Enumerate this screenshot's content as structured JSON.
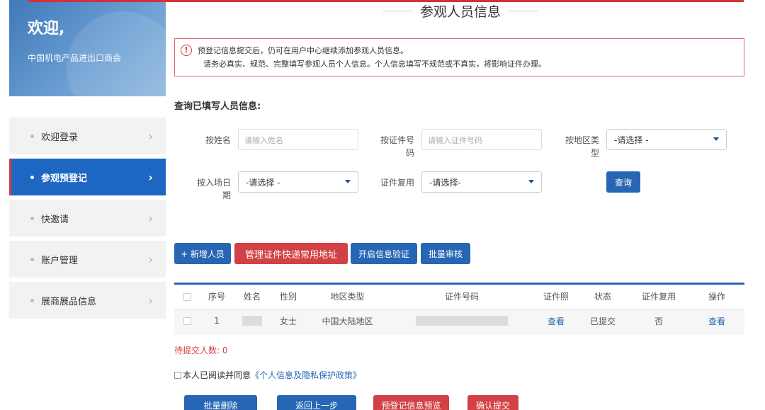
{
  "sidebar": {
    "welcome_title": "欢迎,",
    "organization": "中国机电产品进出口商会",
    "items": [
      {
        "label": "欢迎登录",
        "active": false
      },
      {
        "label": "参观预登记",
        "active": true
      },
      {
        "label": "快邀请",
        "active": false
      },
      {
        "label": "账户管理",
        "active": false
      },
      {
        "label": "展商展品信息",
        "active": false
      }
    ]
  },
  "header": {
    "title": "参观人员信息"
  },
  "notice": {
    "line1": "预登记信息提交后，仍可在用户中心继续添加参观人员信息。",
    "line2": "请务必真实、规范、完整填写参观人员个人信息。个人信息填写不规范或不真实，将影响证件办理。"
  },
  "search": {
    "section_title": "查询已填写人员信息:",
    "name_label": "按姓名",
    "name_placeholder": "请输入姓名",
    "id_label_1": "按证件号",
    "id_label_2": "码",
    "id_placeholder": "请输入证件号码",
    "region_label_1": "按地区类",
    "region_label_2": "型",
    "region_value": "-请选择 -",
    "date_label_1": "按入场日",
    "date_label_2": "期",
    "date_value": "-请选择 -",
    "reuse_label": "证件复用",
    "reuse_value": "-请选择-",
    "query_button": "查询"
  },
  "actions": {
    "add_person": "+ 新增人员",
    "manage_address": "管理证件快递常用地址",
    "enable_verify": "开启信息验证",
    "batch_review": "批量审核"
  },
  "table": {
    "headers": [
      "序号",
      "姓名",
      "性别",
      "地区类型",
      "证件号码",
      "证件照",
      "状态",
      "证件复用",
      "操作"
    ],
    "rows": [
      {
        "index": "1",
        "gender": "女士",
        "region": "中国大陆地区",
        "photo": "查看",
        "status": "已提交",
        "reuse": "否",
        "action": "查看"
      }
    ]
  },
  "footer": {
    "pending_label": "待提交人数: ",
    "pending_count": "0",
    "agree_text": "本人已阅读并同意",
    "policy_link": "《个人信息及隐私保护政策》",
    "batch_delete": "批量删除",
    "back": "返回上一步",
    "preview": "预登记信息预览",
    "confirm": "确认提交"
  },
  "colors": {
    "primary": "#2766b4",
    "danger": "#d24145",
    "active_menu": "#1d67c2"
  }
}
